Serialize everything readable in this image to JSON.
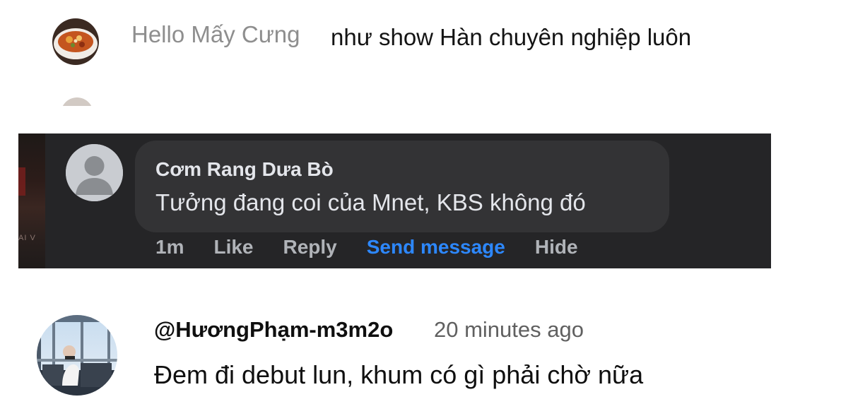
{
  "comment_top": {
    "author": "Hello Mấy Cưng",
    "text": "như show Hàn chuyên nghiệp luôn",
    "avatar_icon": "food-bowl-avatar"
  },
  "facebook_comment": {
    "author": "Cơm Rang Dưa Bò",
    "text": "Tưởng đang coi của Mnet, KBS không đó",
    "avatar_icon": "default-user-avatar",
    "actions": {
      "time": "1m",
      "like": "Like",
      "reply": "Reply",
      "send_message": "Send message",
      "hide": "Hide"
    },
    "colors": {
      "panel": "#252527",
      "bubble": "#333335",
      "text": "#e4e6eb",
      "action": "#b0b3b8",
      "link": "#2d88ff"
    }
  },
  "youtube_comment": {
    "author": "@HươngPhạm-m3m2o",
    "time": "20 minutes ago",
    "text": "Đem đi debut lun, khum có gì phải chờ nữa",
    "avatar_icon": "photo-avatar"
  }
}
